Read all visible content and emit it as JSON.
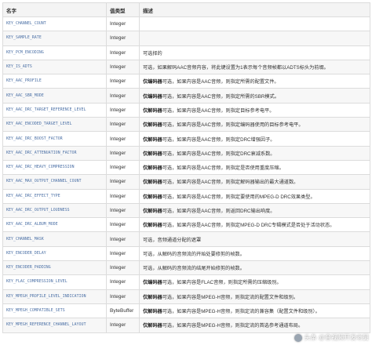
{
  "table": {
    "headers": {
      "key": "名字",
      "type": "值类型",
      "desc": "描述"
    },
    "rows": [
      {
        "key": "KEY_CHANNEL_COUNT",
        "type": "Integer",
        "desc_bold": "",
        "desc": ""
      },
      {
        "key": "KEY_SAMPLE_RATE",
        "type": "Integer",
        "desc_bold": "",
        "desc": ""
      },
      {
        "key": "KEY_PCM_ENCODING",
        "type": "Integer",
        "desc_bold": "",
        "desc": "可选择的"
      },
      {
        "key": "KEY_IS_ADTS",
        "type": "Integer",
        "desc_bold": "",
        "desc": "可选，如果解码AAC音频内容，将此键设置为1表示每个音频帧都以ADTS标头为前缀。"
      },
      {
        "key": "KEY_AAC_PROFILE",
        "type": "Integer",
        "desc_bold": "仅编码器",
        "desc": "可选，如果内容是AAC音频，则指定所需的配置文件。"
      },
      {
        "key": "KEY_AAC_SBR_MODE",
        "type": "Integer",
        "desc_bold": "仅编码器",
        "desc": "可选，如果内容是AAC音频，则指定所需的SBR模式。"
      },
      {
        "key": "KEY_AAC_DRC_TARGET_REFERENCE_LEVEL",
        "type": "Integer",
        "desc_bold": "仅解码器",
        "desc": "可选，如果内容是AAC音频，则指定目标参考电平。"
      },
      {
        "key": "KEY_AAC_ENCODED_TARGET_LEVEL",
        "type": "Integer",
        "desc_bold": "仅解码器",
        "desc": "可选，如果内容是AAC音频，则指定编码器使用的目标参考电平。"
      },
      {
        "key": "KEY_AAC_DRC_BOOST_FACTOR",
        "type": "Integer",
        "desc_bold": "仅解码器",
        "desc": "可选，如果内容是AAC音频，则指定DRC增强因子。"
      },
      {
        "key": "KEY_AAC_DRC_ATTENUATION_FACTOR",
        "type": "Integer",
        "desc_bold": "仅解码器",
        "desc": "可选，如果内容是AAC音频，则指定DRC衰减系数。"
      },
      {
        "key": "KEY_AAC_DRC_HEAVY_COMPRESSION",
        "type": "Integer",
        "desc_bold": "仅解码器",
        "desc": "可选，如果内容是AAC音频，则指定是否使用重度压缩。"
      },
      {
        "key": "KEY_AAC_MAX_OUTPUT_CHANNEL_COUNT",
        "type": "Integer",
        "desc_bold": "仅解码器",
        "desc": "可选，如果内容是AAC音频，则指定解码器输出的最大通道数。"
      },
      {
        "key": "KEY_AAC_DRC_EFFECT_TYPE",
        "type": "Integer",
        "desc_bold": "仅解码器",
        "desc": "可选，如果内容是AAC音频，则指定要使用的MPEG-D DRC效果类型。"
      },
      {
        "key": "KEY_AAC_DRC_OUTPUT_LOUDNESS",
        "type": "Integer",
        "desc_bold": "仅解码器",
        "desc": "可选，如果内容是AAC音频，则返回DRC输出响度。"
      },
      {
        "key": "KEY_AAC_DRC_ALBUM_MODE",
        "type": "Integer",
        "desc_bold": "仅解码器",
        "desc": "可选，如果内容是AAC音频，则指定MPEG-D DRC专辑模式是否处于活动状态。"
      },
      {
        "key": "KEY_CHANNEL_MASK",
        "type": "Integer",
        "desc_bold": "",
        "desc": "可选，音频通道分配的遮罩"
      },
      {
        "key": "KEY_ENCODER_DELAY",
        "type": "Integer",
        "desc_bold": "",
        "desc": "可选，从解码的音频流的开始处要修剪的帧数。"
      },
      {
        "key": "KEY_ENCODER_PADDING",
        "type": "Integer",
        "desc_bold": "",
        "desc": "可选，从解码的音频流的结尾开始修剪的帧数。"
      },
      {
        "key": "KEY_FLAC_COMPRESSION_LEVEL",
        "type": "Integer",
        "desc_bold": "仅编码器",
        "desc": "可选，如果内容是FLAC音频，则指定所需的压缩级别。"
      },
      {
        "key": "KEY_MPEGH_PROFILE_LEVEL_INDICATION",
        "type": "Integer",
        "desc_bold": "仅解码器",
        "desc": "可选，如果内容是MPEG-H音频，则指定流的配置文件和级别。"
      },
      {
        "key": "KEY_MPEGH_COMPATIBLE_SETS",
        "type": "ByteBuffer",
        "desc_bold": "仅解码器",
        "desc": "可选，如果内容是MPEG-H音频，则指定流的兼容集（配置文件和级别）。"
      },
      {
        "key": "KEY_MPEGH_REFERENCE_CHANNEL_LAYOUT",
        "type": "Integer",
        "desc_bold": "仅解码器",
        "desc": "可选，如果内容是MPEG-H音频，则指定流的首选参考通道布局。"
      }
    ]
  },
  "watermark": {
    "text": "头条 @音视频开发老舅",
    "icon": "avatar-icon"
  }
}
